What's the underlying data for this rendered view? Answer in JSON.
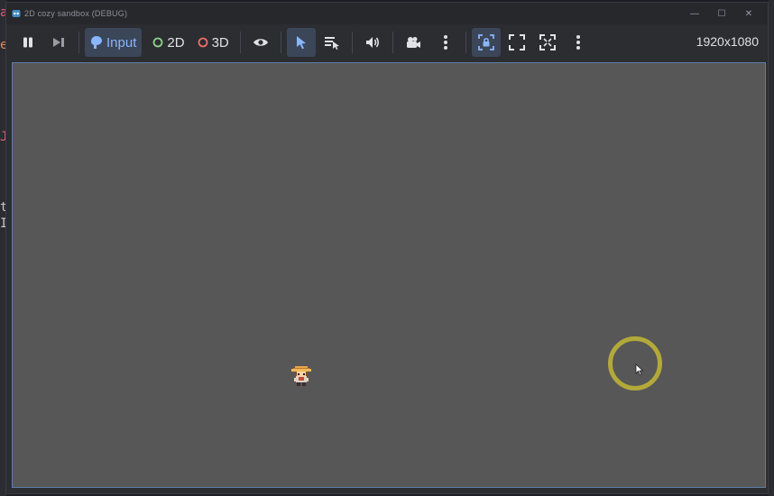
{
  "window": {
    "title": "2D cozy sandbox (DEBUG)",
    "controls": {
      "minimize": "—",
      "maximize": "☐",
      "close": "✕"
    }
  },
  "toolbar": {
    "input_label": "Input",
    "mode_2d_label": "2D",
    "mode_3d_label": "3D",
    "resolution": "1920x1080"
  },
  "behind_text": {
    "a": "a",
    "e": "e",
    "j": "J",
    "t": "t",
    "i": "I"
  },
  "colors": {
    "accent": "#8ab6ff",
    "viewport_bg": "#575757",
    "ring": "#b3a93a",
    "mode_2d_dot": "#8fd18b",
    "mode_3d_dot": "#ef6b6b"
  }
}
